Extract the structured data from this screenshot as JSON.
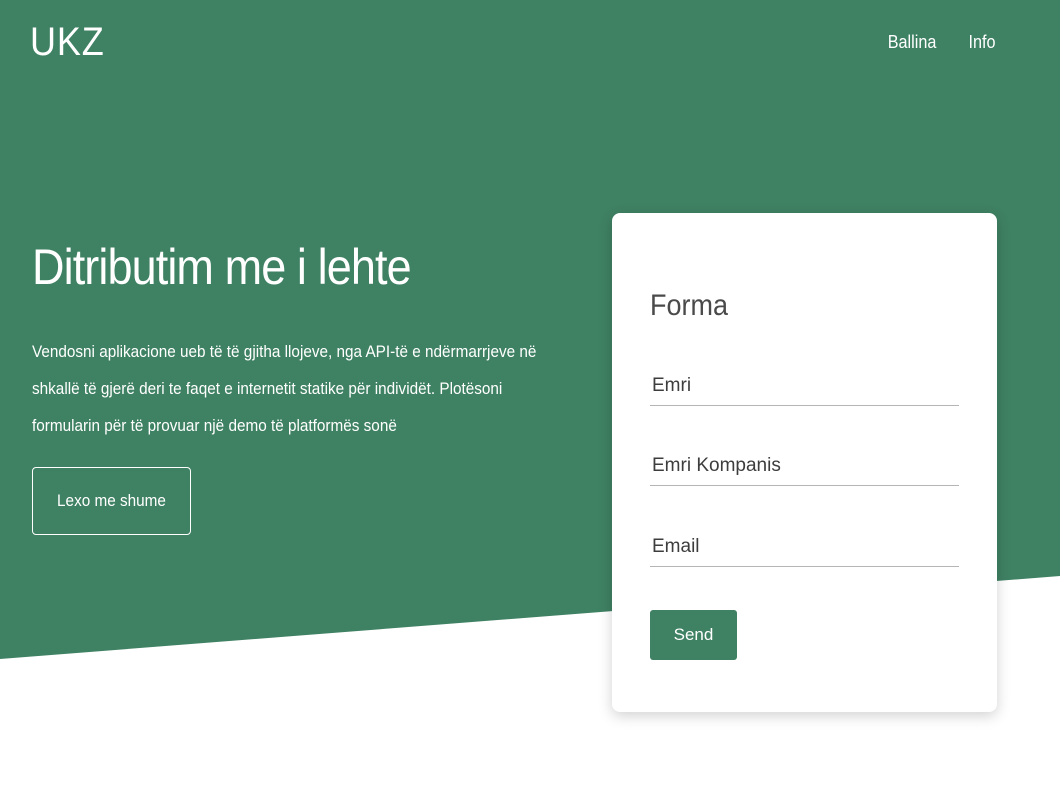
{
  "colors": {
    "brand_green": "#3f8163",
    "background": "#ffffff",
    "card": "#ffffff"
  },
  "header": {
    "logo": "UKZ",
    "nav": [
      {
        "label": "Ballina"
      },
      {
        "label": "Info"
      }
    ]
  },
  "hero": {
    "title": "Ditributim me i lehte",
    "text": "Vendosni aplikacione ueb të të gjitha llojeve, nga API-të e ndërmarrjeve në shkallë të gjerë deri te faqet e internetit statike për individët. Plotësoni formularin për të provuar një demo të platformës sonë",
    "button_label": "Lexo me shume"
  },
  "form": {
    "title": "Forma",
    "fields": {
      "name": {
        "placeholder": "Emri",
        "value": ""
      },
      "company": {
        "placeholder": "Emri Kompanis",
        "value": ""
      },
      "email": {
        "placeholder": "Email",
        "value": ""
      }
    },
    "submit_label": "Send"
  }
}
